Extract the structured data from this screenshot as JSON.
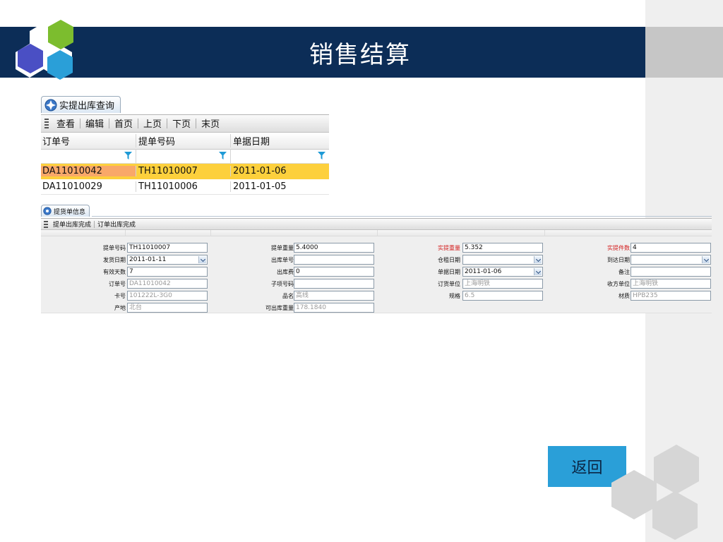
{
  "header": {
    "title": "销售结算"
  },
  "query_window": {
    "tab_label": "实提出库查询",
    "toolbar": [
      "查看",
      "编辑",
      "首页",
      "上页",
      "下页",
      "末页"
    ],
    "columns": [
      "订单号",
      "提单号码",
      "单据日期"
    ],
    "rows": [
      [
        "DA11010042",
        "TH11010007",
        "2011-01-06"
      ],
      [
        "DA11010029",
        "TH11010006",
        "2011-01-05"
      ]
    ],
    "selected_row": 0
  },
  "detail_window": {
    "tab_label": "提货单信息",
    "toolbar": [
      "提单出库完成",
      "订单出库完成"
    ],
    "rows": [
      [
        {
          "label": "提单号码",
          "value": "TH11010007"
        },
        {
          "label": "提单重量",
          "value": "5.4000"
        },
        {
          "label": "实提重量",
          "value": "5.352",
          "label_color": "#d42020"
        },
        {
          "label": "实提件数",
          "value": "4",
          "label_color": "#d42020"
        }
      ],
      [
        {
          "label": "发货日期",
          "value": "2011-01-11",
          "dropdown": true
        },
        {
          "label": "出库单号",
          "value": ""
        },
        {
          "label": "仓租日期",
          "value": "",
          "dropdown": true
        },
        {
          "label": "到达日期",
          "value": "",
          "dropdown": true
        }
      ],
      [
        {
          "label": "有效天数",
          "value": "7"
        },
        {
          "label": "出库费",
          "value": "0"
        },
        {
          "label": "单据日期",
          "value": "2011-01-06",
          "dropdown": true
        },
        {
          "label": "备注",
          "value": ""
        }
      ],
      [
        {
          "label": "订单号",
          "value": "DA11010042",
          "readonly": true
        },
        {
          "label": "子项号码",
          "value": ""
        },
        {
          "label": "订货单位",
          "value": "上海明铁",
          "readonly": true
        },
        {
          "label": "收方单位",
          "value": "上海明铁",
          "readonly": true
        }
      ],
      [
        {
          "label": "卡号",
          "value": "101222L-3G0",
          "readonly": true
        },
        {
          "label": "品名",
          "value": "高线",
          "readonly": true
        },
        {
          "label": "规格",
          "value": "6.5",
          "readonly": true
        },
        {
          "label": "材质",
          "value": "HPB235",
          "readonly": true
        }
      ],
      [
        {
          "label": "产地",
          "value": "北台",
          "readonly": true
        },
        {
          "label": "可出库重量",
          "value": "178.1840",
          "readonly": true
        }
      ]
    ]
  },
  "return_button": {
    "label": "返回"
  },
  "colors": {
    "header_bg": "#0c2d57",
    "selected_row": "#fdd03c",
    "selected_cell": "#f9a869",
    "button_bg": "#2a9fd8",
    "red_label": "#d42020"
  }
}
